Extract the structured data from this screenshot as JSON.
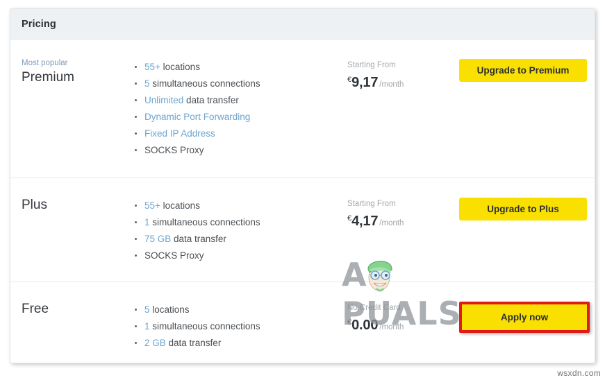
{
  "card": {
    "header_title": "Pricing"
  },
  "plans": [
    {
      "badge": "Most popular",
      "name": "Premium",
      "features": [
        {
          "value": "55+",
          "text": " locations"
        },
        {
          "value": "5",
          "text": " simultaneous connections"
        },
        {
          "value": "Unlimited",
          "text": " data transfer"
        },
        {
          "value": "Dynamic Port Forwarding",
          "text": ""
        },
        {
          "value": "Fixed IP Address",
          "text": ""
        },
        {
          "value": "",
          "text": "SOCKS Proxy"
        }
      ],
      "price_caption": "Starting From",
      "price_currency": "€",
      "price_amount": "9,17",
      "price_period": "/month",
      "cta_label": "Upgrade to Premium",
      "cta_highlighted": false
    },
    {
      "badge": "",
      "name": "Plus",
      "features": [
        {
          "value": "55+",
          "text": " locations"
        },
        {
          "value": "1",
          "text": " simultaneous connections"
        },
        {
          "value": "75 GB",
          "text": " data transfer"
        },
        {
          "value": "",
          "text": "SOCKS Proxy"
        }
      ],
      "price_caption": "Starting From",
      "price_currency": "€",
      "price_amount": "4,17",
      "price_period": "/month",
      "cta_label": "Upgrade to Plus",
      "cta_highlighted": false
    },
    {
      "badge": "",
      "name": "Free",
      "features": [
        {
          "value": "5",
          "text": " locations"
        },
        {
          "value": "1",
          "text": " simultaneous connections"
        },
        {
          "value": "2 GB",
          "text": " data transfer"
        }
      ],
      "price_caption": "No Credit Card",
      "price_currency": "€",
      "price_amount": "0.00",
      "price_period": "/month",
      "cta_label": "Apply now",
      "cta_highlighted": true
    }
  ],
  "watermarks": {
    "appuals": "A PUALS",
    "source": "wsxdn.com"
  },
  "colors": {
    "cta_yellow": "#f9e000",
    "highlight_red": "#e01b16",
    "feature_link_blue": "#6aa5d0",
    "header_bg": "#eef1f4"
  }
}
